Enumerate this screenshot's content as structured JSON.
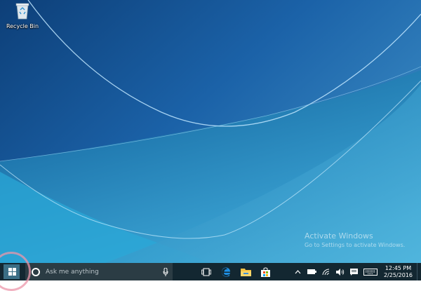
{
  "desktop": {
    "icons": [
      {
        "label": "Recycle Bin",
        "icon": "recycle-bin-icon"
      }
    ],
    "watermark": {
      "title": "Activate Windows",
      "subtitle": "Go to Settings to activate Windows."
    }
  },
  "taskbar": {
    "search_placeholder": "Ask me anything",
    "pinned": [
      "task-view-icon",
      "edge-icon",
      "file-explorer-icon",
      "store-icon"
    ],
    "tray_icons": [
      "chevron-up-icon",
      "battery-icon",
      "wifi-icon",
      "volume-icon",
      "action-center-icon",
      "keyboard-icon"
    ],
    "clock": {
      "time": "12:45 PM",
      "date": "2/25/2016"
    }
  },
  "colors": {
    "taskbar": "#132731",
    "search_box": "#2b3c44",
    "accent": "#0078d7",
    "highlight_ring": "#ec96aa"
  }
}
